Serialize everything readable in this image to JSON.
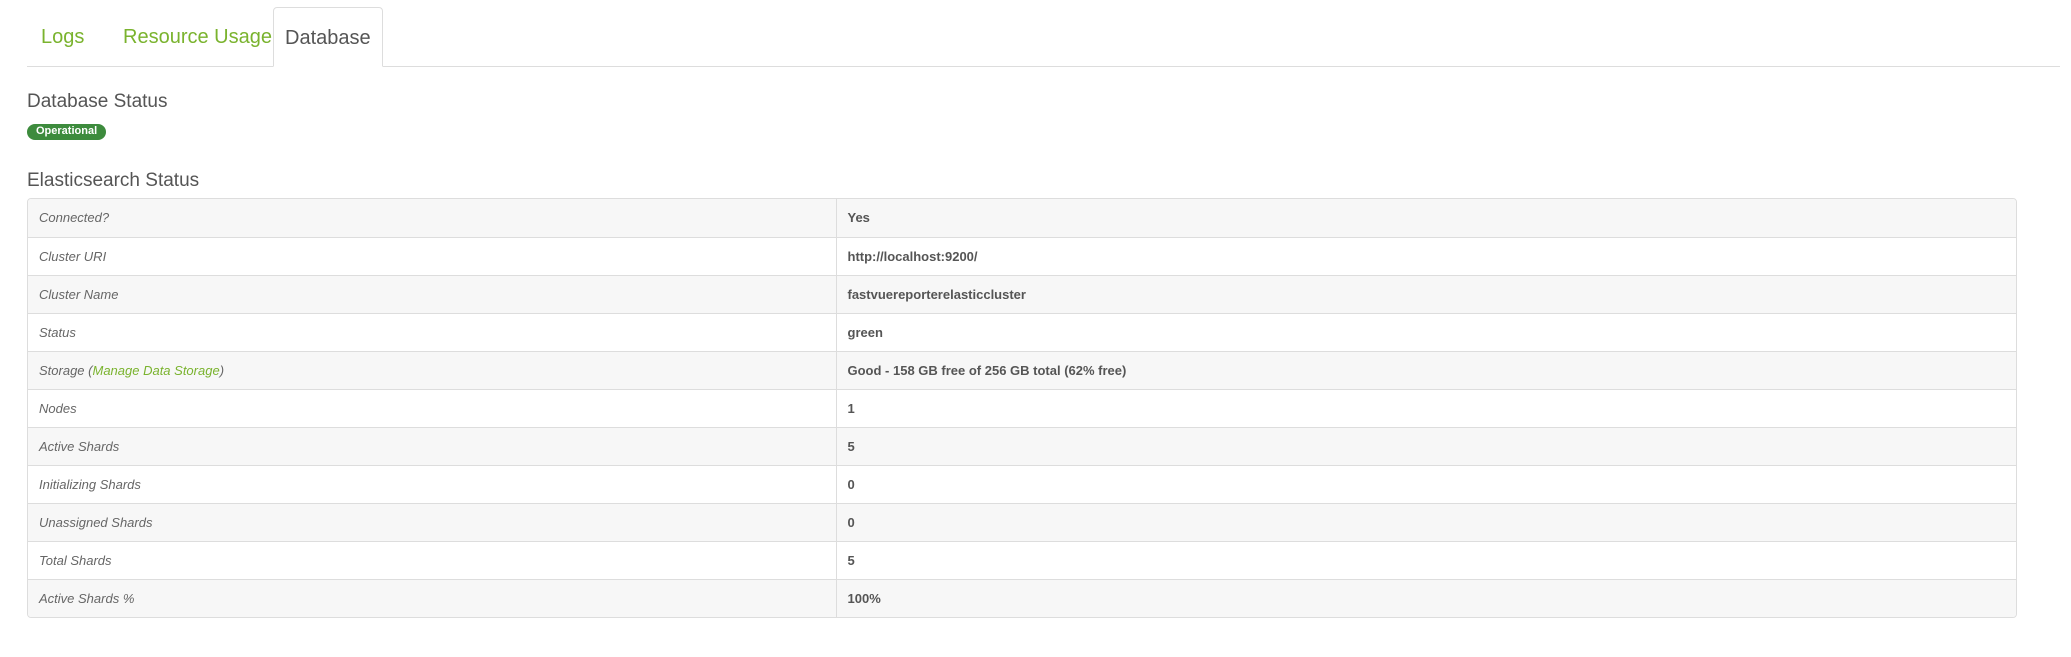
{
  "tabs": [
    {
      "label": "Logs",
      "active": false
    },
    {
      "label": "Resource Usage",
      "active": false
    },
    {
      "label": "Database",
      "active": true
    }
  ],
  "database_status": {
    "heading": "Database Status",
    "badge": "Operational",
    "badge_color": "#3d8b3d"
  },
  "elasticsearch_status": {
    "heading": "Elasticsearch Status",
    "rows": [
      {
        "label": "Connected?",
        "value": "Yes"
      },
      {
        "label": "Cluster URI",
        "value": "http://localhost:9200/"
      },
      {
        "label": "Cluster Name",
        "value": "fastvuereporterelasticcluster"
      },
      {
        "label": "Status",
        "value": "green"
      },
      {
        "label_prefix": "Storage (",
        "link": "Manage Data Storage",
        "label_suffix": ")",
        "value": "Good - 158 GB free of 256 GB total (62% free)"
      },
      {
        "label": "Nodes",
        "value": "1"
      },
      {
        "label": "Active Shards",
        "value": "5"
      },
      {
        "label": "Initializing Shards",
        "value": "0"
      },
      {
        "label": "Unassigned Shards",
        "value": "0"
      },
      {
        "label": "Total Shards",
        "value": "5"
      },
      {
        "label": "Active Shards %",
        "value": "100%"
      }
    ]
  },
  "colors": {
    "accent": "#7ab32e",
    "text": "#555555",
    "border": "#dddddd",
    "stripe": "#f7f7f7"
  }
}
